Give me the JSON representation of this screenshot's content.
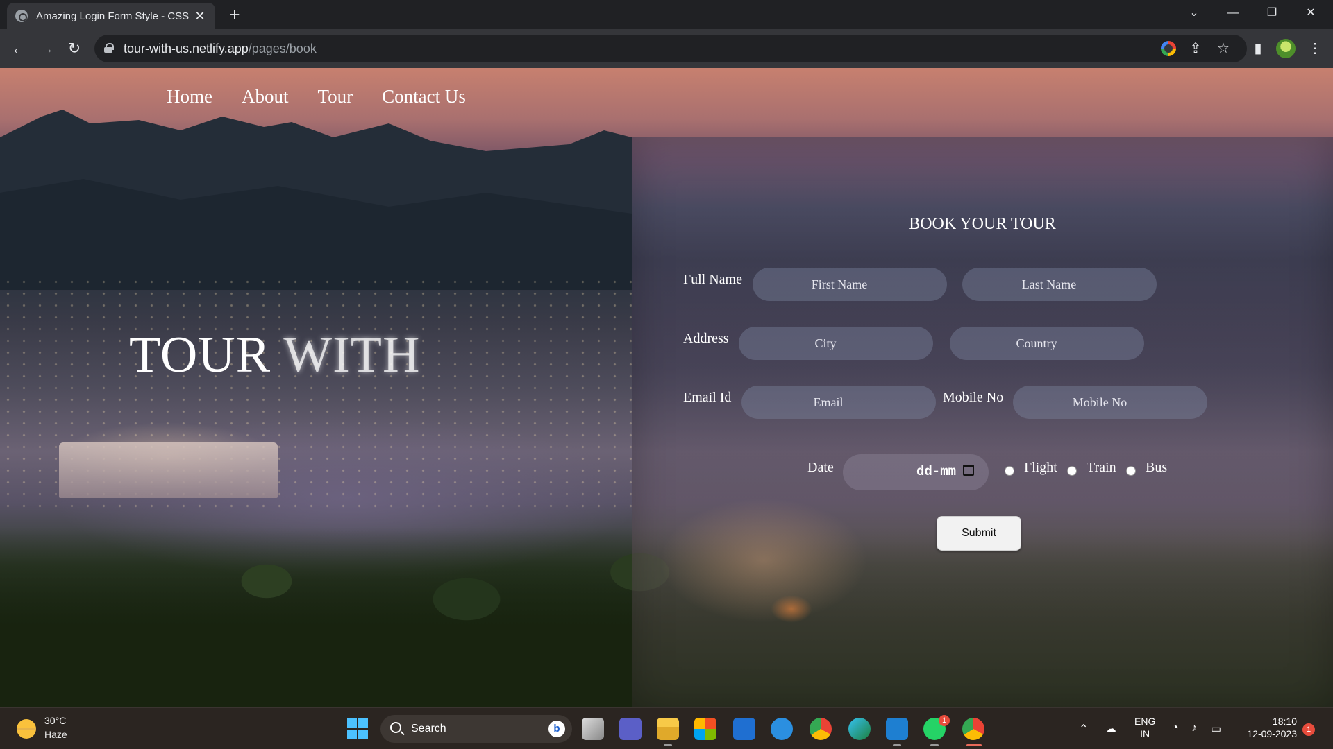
{
  "browser": {
    "tab_title": "Amazing Login Form Style - CSS",
    "url_host": "tour-with-us.netlify.app",
    "url_path": "/pages/book"
  },
  "page": {
    "nav": [
      "Home",
      "About",
      "Tour",
      "Contact Us"
    ],
    "hero_word1": "TOUR",
    "hero_word2": "WITH",
    "form": {
      "title": "BOOK YOUR TOUR",
      "full_name_label": "Full Name",
      "first_name_placeholder": "First Name",
      "last_name_placeholder": "Last Name",
      "address_label": "Address",
      "city_placeholder": "City",
      "country_placeholder": "Country",
      "email_label": "Email Id",
      "email_placeholder": "Email",
      "mobile_label": "Mobile No",
      "mobile_placeholder": "Mobile No",
      "date_label": "Date",
      "date_value": "dd-mm",
      "transport_options": [
        "Flight",
        "Train",
        "Bus"
      ],
      "submit_label": "Submit"
    }
  },
  "taskbar": {
    "weather_temp": "30°C",
    "weather_desc": "Haze",
    "search_label": "Search",
    "bing_letter": "b",
    "whatsapp_badge": "1",
    "lang_line1": "ENG",
    "lang_line2": "IN",
    "time": "18:10",
    "date": "12-09-2023",
    "notification_count": "1"
  },
  "colors": {
    "accent_blue": "#4cc2ff",
    "panel_glass": "#5a506e",
    "input_fill": "#828ca5"
  }
}
